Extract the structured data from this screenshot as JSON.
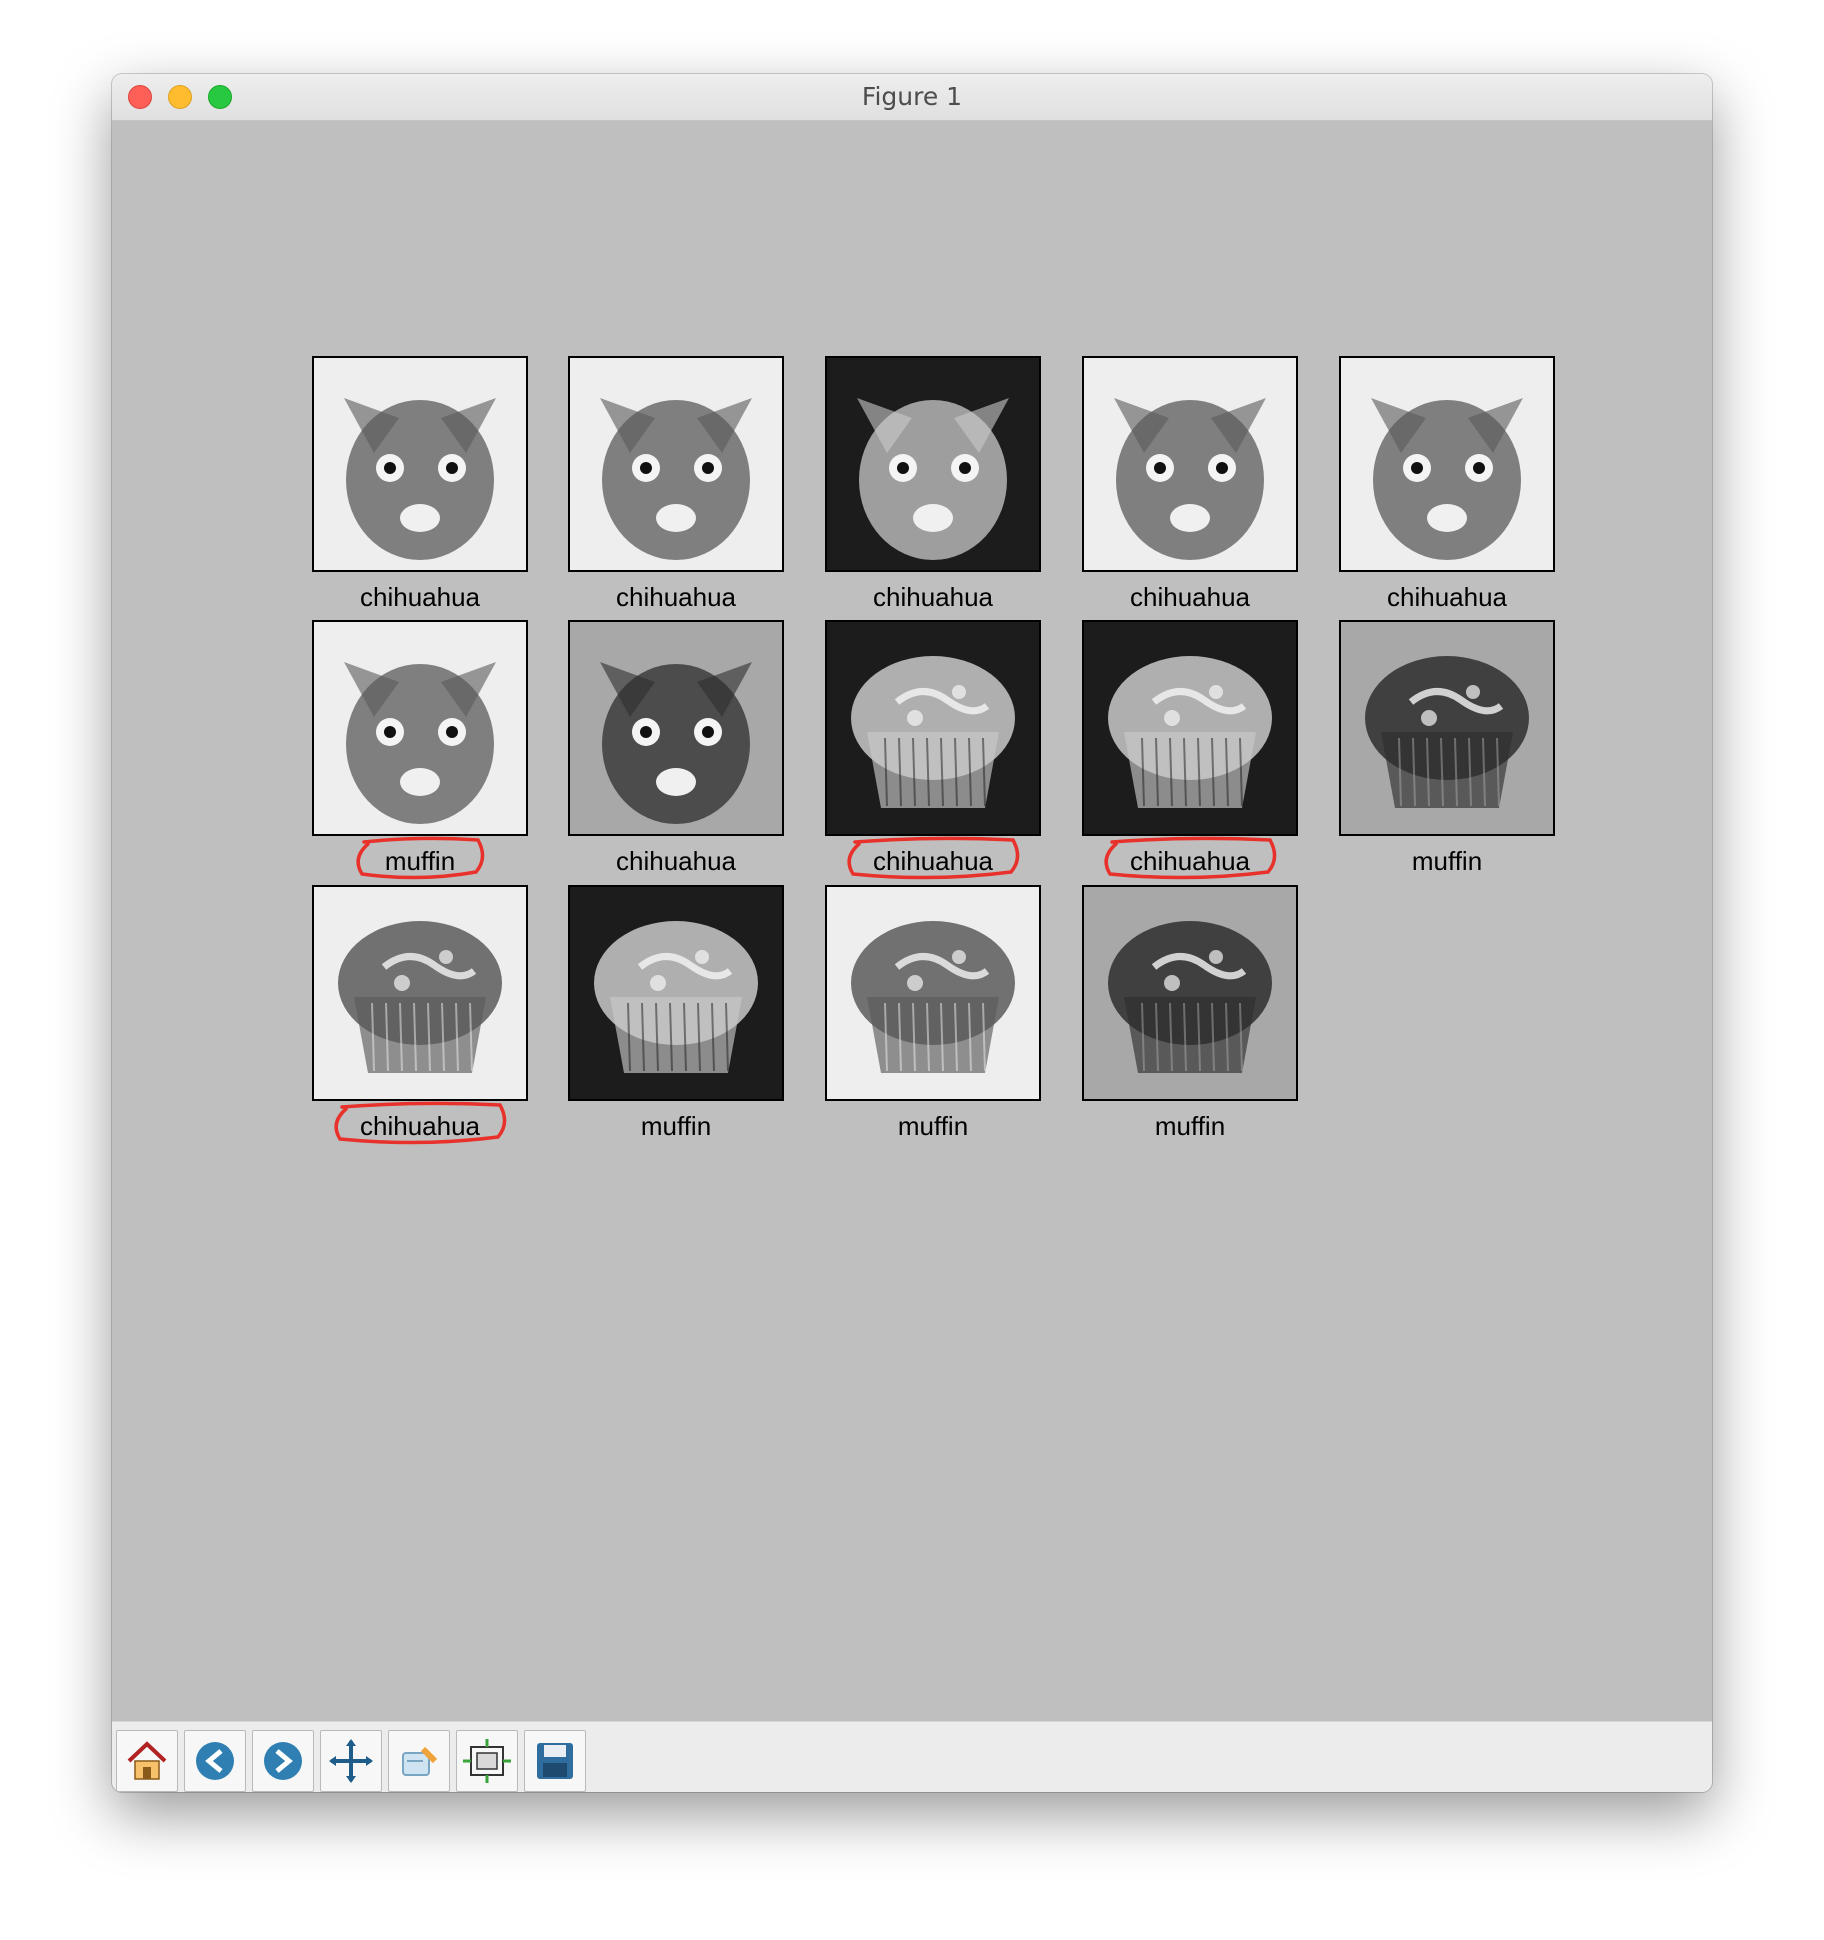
{
  "window": {
    "title": "Figure 1"
  },
  "figure": {
    "tiles": [
      {
        "label": "chihuahua",
        "subject": "chihuahua-face",
        "tone": "light"
      },
      {
        "label": "chihuahua",
        "subject": "chihuahua-face-closeup",
        "tone": "light"
      },
      {
        "label": "chihuahua",
        "subject": "chihuahua-nose",
        "tone": "dark"
      },
      {
        "label": "chihuahua",
        "subject": "chihuahua-profile",
        "tone": "light"
      },
      {
        "label": "chihuahua",
        "subject": "chihuahua-sleeping",
        "tone": "light"
      },
      {
        "label": "muffin",
        "subject": "chihuahua-with-toy",
        "tone": "light",
        "circled": true
      },
      {
        "label": "chihuahua",
        "subject": "chihuahua-face-front",
        "tone": "medium"
      },
      {
        "label": "chihuahua",
        "subject": "muffin-side",
        "tone": "dark",
        "circled": true
      },
      {
        "label": "chihuahua",
        "subject": "muffin-top",
        "tone": "dark",
        "circled": true
      },
      {
        "label": "muffin",
        "subject": "muffin-top-round",
        "tone": "medium"
      },
      {
        "label": "chihuahua",
        "subject": "muffin-tray",
        "tone": "light",
        "circled": true
      },
      {
        "label": "muffin",
        "subject": "muffin-side",
        "tone": "dark"
      },
      {
        "label": "muffin",
        "subject": "muffin-top",
        "tone": "light"
      },
      {
        "label": "muffin",
        "subject": "muffin-side",
        "tone": "medium"
      }
    ]
  },
  "toolbar": {
    "buttons": [
      {
        "name": "home-button",
        "icon": "home-icon"
      },
      {
        "name": "back-button",
        "icon": "back-arrow-icon"
      },
      {
        "name": "forward-button",
        "icon": "forward-arrow-icon"
      },
      {
        "name": "pan-button",
        "icon": "pan-icon"
      },
      {
        "name": "zoom-button",
        "icon": "zoom-icon"
      },
      {
        "name": "configure-subplots-button",
        "icon": "subplots-icon"
      },
      {
        "name": "save-button",
        "icon": "save-icon"
      }
    ]
  },
  "colors": {
    "canvas": "#bfbfbf",
    "annotation": "#e8312a",
    "toolbar": "#ececec"
  }
}
